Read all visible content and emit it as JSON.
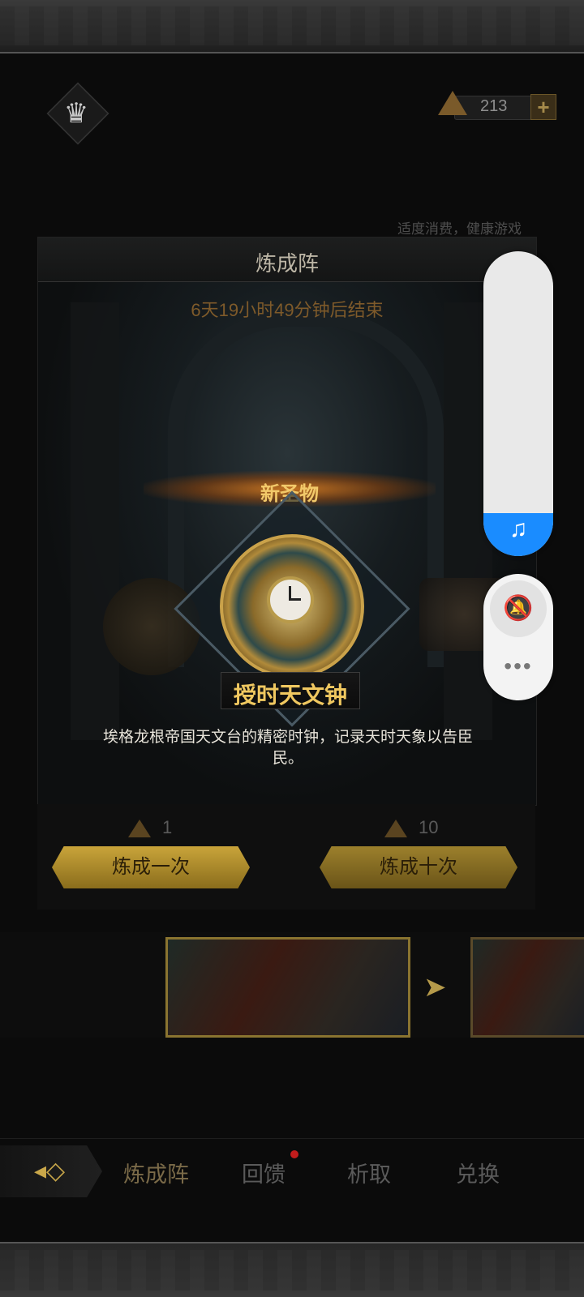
{
  "header": {
    "currency_amount": "213",
    "currency_add": "+",
    "notice": "适度消费，健康游戏"
  },
  "panel": {
    "title": "炼成阵",
    "timer": "6天19小时49分钟后结束",
    "new_label": "新圣物",
    "relic_name": "授时天文钟",
    "relic_description": "埃格龙根帝国天文台的精密时钟，记录天时天象以告臣民。"
  },
  "draw": {
    "single_cost": "1",
    "single_label": "炼成一次",
    "ten_cost": "10",
    "ten_label": "炼成十次"
  },
  "carousel": {
    "next_arrow": "➤"
  },
  "nav": {
    "back_glyph": "◂◇",
    "tabs": [
      "炼成阵",
      "回馈",
      "析取",
      "兑换"
    ]
  },
  "overlay": {
    "music_glyph": "♫",
    "bell_glyph": "🔕",
    "more_glyph": "•••",
    "volume_level": 0.14
  },
  "icons": {
    "crown": "crown-icon",
    "gem": "gem-icon",
    "bell_off": "bell-off-icon",
    "music": "music-note-icon"
  },
  "colors": {
    "accent_gold": "#f0c860",
    "system_blue": "#1a8cff",
    "notification_red": "#c21c1c"
  }
}
